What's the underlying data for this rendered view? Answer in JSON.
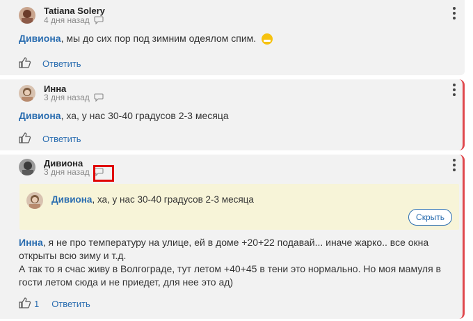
{
  "comments": [
    {
      "author": "Tatiana Solery",
      "time": "4 дня назад",
      "mention": "Дивиона",
      "text": ", мы до сих пор под зимним одеялом спим.",
      "reply_label": "Ответить"
    },
    {
      "author": "Инна",
      "time": "3 дня назад",
      "mention": "Дивиона",
      "text": ", ха, у нас 30-40 градусов 2-3 месяца",
      "reply_label": "Ответить"
    },
    {
      "author": "Дивиона",
      "time": "3 дня назад",
      "quote": {
        "mention": "Дивиона",
        "text": ", ха, у нас 30-40 градусов 2-3 месяца",
        "hide_label": "Скрыть"
      },
      "mention": "Инна",
      "text_line1": ", я не про температуру на улице, ей в доме +20+22 подавай... иначе жарко.. все окна",
      "text_line2": "открыты всю зиму и т.д.",
      "text_line3": "А так то я счас живу в Волгограде, тут летом +40+45 в тени это нормально. Но моя мамуля в",
      "text_line4": "гости летом сюда и не приедет, для нее это ад)",
      "likes": "1",
      "reply_label": "Ответить"
    }
  ],
  "icons": {
    "reply_bubble": "speech-bubble-icon",
    "like": "thumbs-up-icon",
    "menu": "kebab-menu-icon",
    "emoji": "grinning-emoji-icon"
  },
  "colors": {
    "link": "#2a6db0",
    "accent_border": "#e0474c",
    "quote_bg": "#f7f4d8",
    "highlight": "#e00000"
  }
}
